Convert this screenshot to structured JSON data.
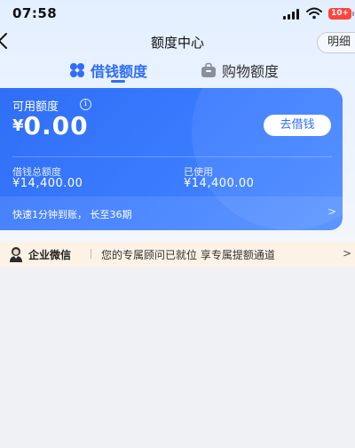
{
  "status_bar": {
    "time": "07:58",
    "battery": "10+"
  },
  "nav": {
    "title": "额度中心",
    "detail_label": "明细"
  },
  "tabs": [
    {
      "label": "借钱额度",
      "active": true,
      "icon": "clover-icon"
    },
    {
      "label": "购物额度",
      "active": false,
      "icon": "bag-icon"
    }
  ],
  "card": {
    "available_label": "可用额度",
    "info_icon_glyph": "i",
    "currency": "¥",
    "available_amount": "0.00",
    "borrow_button": "去借钱",
    "total_label": "借钱总额度",
    "total_value": "¥14,400.00",
    "used_label": "已使用",
    "used_value": "¥14,400.00",
    "promo": "快速1分钟到账， 长至36期",
    "promo_arrow": ">"
  },
  "wecom": {
    "name": "企业微信",
    "message": "您的专属顾问已就位 享专属提额通道",
    "arrow": ">"
  },
  "colors": {
    "accent": "#2f6ef6",
    "battery": "#ff453a",
    "banner_bg": "#fdf2e6"
  }
}
